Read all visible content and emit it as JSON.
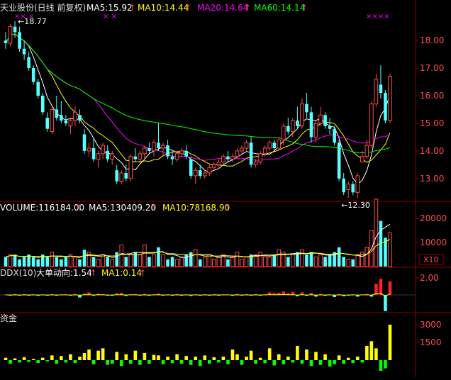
{
  "colors": {
    "bg": "#000000",
    "frame": "#8b0000",
    "up": "#ff4c4c",
    "down": "#54ffff",
    "ma5": "#ffffff",
    "ma10": "#ffff00",
    "ma20": "#ff00ff",
    "ma60": "#00ff00",
    "axis_text": "#ff4c4c",
    "fund_up": "#ffff00",
    "fund_down": "#00ff00",
    "header_text": "#dddddd"
  },
  "price_panel": {
    "title": "天业股份(日线 前复权)",
    "legend": [
      {
        "label": "MA5:15.92",
        "color": "#ffffff"
      },
      {
        "label": "MA10:14.44",
        "color": "#ffff00"
      },
      {
        "label": "MA20:14.64",
        "color": "#ff00ff"
      },
      {
        "label": "MA60:14.14",
        "color": "#00ff00"
      }
    ],
    "high_marker": "18.77",
    "low_marker": "12.30",
    "markers_left": "××  ×",
    "markers_mid": "× ×",
    "markers_right": "××××",
    "axis_ticks": [
      "18.00",
      "17.00",
      "16.00",
      "15.00",
      "14.00",
      "13.00"
    ]
  },
  "volume_panel": {
    "legend": [
      {
        "label": "VOLUME:116184.00",
        "color": "#ffffff"
      },
      {
        "label": "MA5:130409.20",
        "color": "#ffffff"
      },
      {
        "label": "MA10:78168.90",
        "color": "#ffff00"
      }
    ],
    "axis_ticks": [
      "20000",
      "10000"
    ],
    "unit_badge": "X10"
  },
  "ddx_panel": {
    "legend": [
      {
        "label": "DDX(10)",
        "color": "#dddddd"
      },
      {
        "label": "大单动向:1.54",
        "color": "#ffffff"
      },
      {
        "label": "MA1:0.14",
        "color": "#ffff00"
      }
    ],
    "axis_ticks": [
      "2.00"
    ]
  },
  "fund_panel": {
    "title": "资金",
    "axis_ticks": [
      "3000",
      "1500"
    ]
  },
  "chart_data": {
    "type": "candlestick",
    "y_range": [
      12.2,
      18.9
    ],
    "candles": [
      [
        18.0,
        18.3,
        17.7,
        17.9
      ],
      [
        17.9,
        18.6,
        17.8,
        18.5
      ],
      [
        18.5,
        18.7,
        18.1,
        18.3
      ],
      [
        18.3,
        18.5,
        17.6,
        17.7
      ],
      [
        17.7,
        18.0,
        17.3,
        17.5
      ],
      [
        17.4,
        17.6,
        16.9,
        17.0
      ],
      [
        17.0,
        17.1,
        16.4,
        16.5
      ],
      [
        16.5,
        16.6,
        15.9,
        16.0
      ],
      [
        16.0,
        16.1,
        15.3,
        15.4
      ],
      [
        15.2,
        15.4,
        14.7,
        14.8
      ],
      [
        14.7,
        15.6,
        14.6,
        15.5
      ],
      [
        15.5,
        16.0,
        15.1,
        15.2
      ],
      [
        15.3,
        15.8,
        15.0,
        15.1
      ],
      [
        15.1,
        15.3,
        14.9,
        15.0
      ],
      [
        14.9,
        15.2,
        14.6,
        15.1
      ],
      [
        15.1,
        15.6,
        14.9,
        15.4
      ],
      [
        15.3,
        15.5,
        15.0,
        15.1
      ],
      [
        14.6,
        14.8,
        13.9,
        14.0
      ],
      [
        14.0,
        14.3,
        13.8,
        14.1
      ],
      [
        14.1,
        14.5,
        13.6,
        13.7
      ],
      [
        13.7,
        14.0,
        13.4,
        13.9
      ],
      [
        13.9,
        14.3,
        13.7,
        14.2
      ],
      [
        14.0,
        14.2,
        13.6,
        13.7
      ],
      [
        13.7,
        14.0,
        13.5,
        13.9
      ],
      [
        13.3,
        13.5,
        12.8,
        12.9
      ],
      [
        12.9,
        13.3,
        12.8,
        13.2
      ],
      [
        13.2,
        13.5,
        12.9,
        13.0
      ],
      [
        13.0,
        13.9,
        12.9,
        13.8
      ],
      [
        13.8,
        14.1,
        13.6,
        13.7
      ],
      [
        13.7,
        14.0,
        13.5,
        13.9
      ],
      [
        13.9,
        14.2,
        13.7,
        14.1
      ],
      [
        14.1,
        14.3,
        13.9,
        14.0
      ],
      [
        14.0,
        14.4,
        13.8,
        14.3
      ],
      [
        14.3,
        15.0,
        14.0,
        14.1
      ],
      [
        14.1,
        14.3,
        13.8,
        14.2
      ],
      [
        14.2,
        14.4,
        13.7,
        13.8
      ],
      [
        13.8,
        14.0,
        13.5,
        13.7
      ],
      [
        13.7,
        14.0,
        13.6,
        13.9
      ],
      [
        13.9,
        14.1,
        13.8,
        14.0
      ],
      [
        14.0,
        14.2,
        13.7,
        13.8
      ],
      [
        13.7,
        13.8,
        13.0,
        13.1
      ],
      [
        13.1,
        13.4,
        12.8,
        13.3
      ],
      [
        13.3,
        13.5,
        13.0,
        13.1
      ],
      [
        13.1,
        13.3,
        13.0,
        13.2
      ],
      [
        13.2,
        13.5,
        13.1,
        13.4
      ],
      [
        13.4,
        13.6,
        13.3,
        13.5
      ],
      [
        13.5,
        13.7,
        13.4,
        13.6
      ],
      [
        13.6,
        13.9,
        13.5,
        13.8
      ],
      [
        13.8,
        14.0,
        13.6,
        13.7
      ],
      [
        13.7,
        13.9,
        13.6,
        13.8
      ],
      [
        13.8,
        14.1,
        13.7,
        14.0
      ],
      [
        14.0,
        14.2,
        13.9,
        14.1
      ],
      [
        14.1,
        14.4,
        14.0,
        14.3
      ],
      [
        14.3,
        14.5,
        13.4,
        13.5
      ],
      [
        13.5,
        13.7,
        13.4,
        13.6
      ],
      [
        13.6,
        14.0,
        13.5,
        13.9
      ],
      [
        13.9,
        14.2,
        13.8,
        14.1
      ],
      [
        14.1,
        14.4,
        14.0,
        14.3
      ],
      [
        14.3,
        14.4,
        14.0,
        14.1
      ],
      [
        14.1,
        14.5,
        14.0,
        14.4
      ],
      [
        14.4,
        15.0,
        14.2,
        14.9
      ],
      [
        14.9,
        15.2,
        14.6,
        14.7
      ],
      [
        14.7,
        15.2,
        14.5,
        15.1
      ],
      [
        15.1,
        15.6,
        14.8,
        14.9
      ],
      [
        14.9,
        15.9,
        14.8,
        15.7
      ],
      [
        15.7,
        16.1,
        15.2,
        15.4
      ],
      [
        15.4,
        15.6,
        14.3,
        14.5
      ],
      [
        14.5,
        15.1,
        14.3,
        15.0
      ],
      [
        15.0,
        15.6,
        14.9,
        15.3
      ],
      [
        15.3,
        15.4,
        14.8,
        14.9
      ],
      [
        14.9,
        15.2,
        14.6,
        14.8
      ],
      [
        14.8,
        14.9,
        14.2,
        14.3
      ],
      [
        14.3,
        14.4,
        12.9,
        13.0
      ],
      [
        13.0,
        13.2,
        12.4,
        12.5
      ],
      [
        12.6,
        12.9,
        12.3,
        12.8
      ],
      [
        12.8,
        12.9,
        12.4,
        12.5
      ],
      [
        12.5,
        13.2,
        12.3,
        13.1
      ],
      [
        13.6,
        14.0,
        13.6,
        13.8
      ],
      [
        13.8,
        14.4,
        13.7,
        14.2
      ],
      [
        14.2,
        15.8,
        14.1,
        15.7
      ],
      [
        15.7,
        16.8,
        15.6,
        16.6
      ],
      [
        16.4,
        17.1,
        15.9,
        16.1
      ],
      [
        16.1,
        16.2,
        15.0,
        15.1
      ],
      [
        15.1,
        16.8,
        15.0,
        16.7
      ]
    ],
    "volume": [
      4,
      5,
      5,
      3,
      4,
      5,
      4,
      3,
      5,
      4,
      6,
      4,
      3,
      4,
      5,
      4,
      3,
      7,
      6,
      4,
      3,
      5,
      4,
      3,
      6,
      9,
      4,
      5,
      6,
      5,
      9,
      4,
      5,
      8,
      5,
      3,
      4,
      3,
      4,
      5,
      6,
      7,
      3,
      4,
      5,
      3,
      4,
      5,
      3,
      4,
      6,
      3,
      4,
      5,
      5,
      6,
      4,
      4,
      5,
      7,
      6,
      4,
      5,
      6,
      7,
      5,
      6,
      4,
      5,
      4,
      5,
      6,
      8,
      4,
      3,
      3,
      5,
      6,
      8,
      15,
      28,
      19,
      12,
      14
    ],
    "ddx": [
      0.05,
      -0.08,
      0.1,
      -0.05,
      0.08,
      -0.03,
      0.06,
      -0.1,
      0.05,
      -0.06,
      0.1,
      -0.08,
      0.05,
      0.07,
      -0.05,
      0.1,
      -0.3,
      0.15,
      0.3,
      -0.1,
      0.15,
      0.1,
      -0.05,
      -0.1,
      0.2,
      0.25,
      -0.12,
      0.08,
      0.1,
      -0.05,
      0.12,
      -0.1,
      0.05,
      0.15,
      -0.08,
      0.06,
      -0.05,
      0.08,
      -0.04,
      0.06,
      -0.12,
      0.05,
      -0.06,
      0.07,
      -0.05,
      0.08,
      -0.04,
      0.06,
      0.05,
      -0.1,
      0.12,
      -0.05,
      0.08,
      -0.06,
      0.1,
      -0.07,
      0.05,
      0.3,
      0.2,
      0.25,
      0.4,
      0.2,
      0.35,
      -0.15,
      0.3,
      -0.1,
      0.25,
      -0.2,
      0.1,
      -0.1,
      0.05,
      -0.25,
      0.1,
      -0.15,
      -0.08,
      0.06,
      -0.2,
      0.05,
      0.1,
      -0.2,
      1.3,
      1.9,
      -1.9,
      1.6
    ],
    "fund": [
      200,
      -300,
      150,
      -200,
      250,
      -150,
      100,
      -250,
      200,
      -100,
      400,
      -300,
      350,
      -200,
      500,
      -250,
      300,
      600,
      900,
      -350,
      800,
      1000,
      -400,
      -300,
      700,
      -500,
      500,
      -300,
      800,
      -400,
      600,
      -300,
      450,
      400,
      -350,
      300,
      -250,
      500,
      -300,
      350,
      -400,
      300,
      -500,
      400,
      -300,
      250,
      -200,
      300,
      -350,
      900,
      500,
      -400,
      300,
      800,
      -300,
      200,
      -250,
      1000,
      -450,
      500,
      -350,
      300,
      -200,
      1200,
      -300,
      900,
      -500,
      700,
      -400,
      500,
      -550,
      -350,
      400,
      -300,
      200,
      -250,
      300,
      -200,
      1200,
      1600,
      1000,
      -900,
      -700,
      3000
    ]
  }
}
